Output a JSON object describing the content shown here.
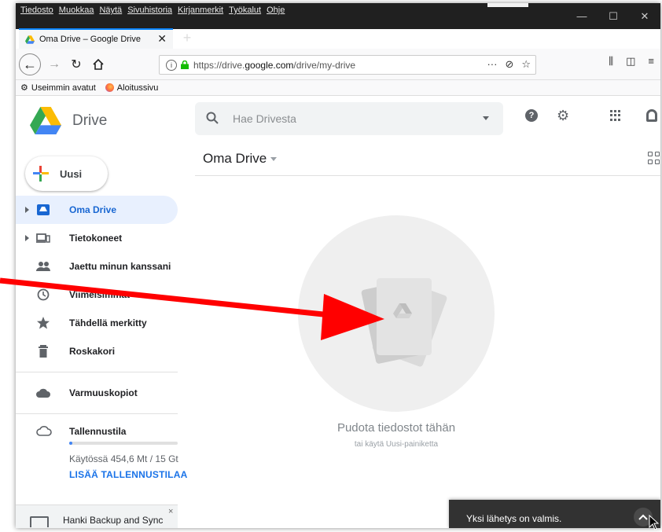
{
  "browser": {
    "menu": [
      "Tiedosto",
      "Muokkaa",
      "Näytä",
      "Sivuhistoria",
      "Kirjanmerkit",
      "Työkalut",
      "Ohje"
    ],
    "window_controls": [
      "—",
      "☐",
      "✕"
    ],
    "tab_title": "Oma Drive – Google Drive",
    "tab_close": "✕",
    "new_tab": "+",
    "url_prefix": "https://drive.",
    "url_domain": "google.com",
    "url_path": "/drive/my-drive",
    "bookmarks": [
      "Useimmin avatut",
      "Aloitussivu"
    ]
  },
  "drive": {
    "brand": "Drive",
    "search_placeholder": "Hae Drivesta",
    "new_button": "Uusi",
    "nav": [
      {
        "label": "Oma Drive",
        "icon": "my-drive-icon",
        "active": true
      },
      {
        "label": "Tietokoneet",
        "icon": "computers-icon"
      },
      {
        "label": "Jaettu minun kanssani",
        "icon": "shared-icon"
      },
      {
        "label": "Viimeisimmät",
        "icon": "recent-icon"
      },
      {
        "label": "Tähdellä merkitty",
        "icon": "star-icon"
      },
      {
        "label": "Roskakori",
        "icon": "trash-icon"
      },
      {
        "label": "Varmuuskopiot",
        "icon": "backups-icon"
      }
    ],
    "storage": {
      "label": "Tallennustila",
      "used_text": "Käytössä 454,6 Mt / 15 Gt",
      "used_fraction": 0.03,
      "link": "LISÄÄ TALLENNUSTILAA"
    },
    "backup_promo": "Hanki Backup and Sync",
    "backup_promo_close": "×",
    "main_title": "Oma Drive",
    "drop_title": "Pudota tiedostot tähän",
    "drop_subtitle": "tai käytä Uusi-painiketta",
    "snackbar": "Yksi lähetys on valmis.",
    "colors": {
      "accent": "#1a73e8",
      "active_bg": "#e8f0fe",
      "arrow": "#ff0000"
    }
  }
}
